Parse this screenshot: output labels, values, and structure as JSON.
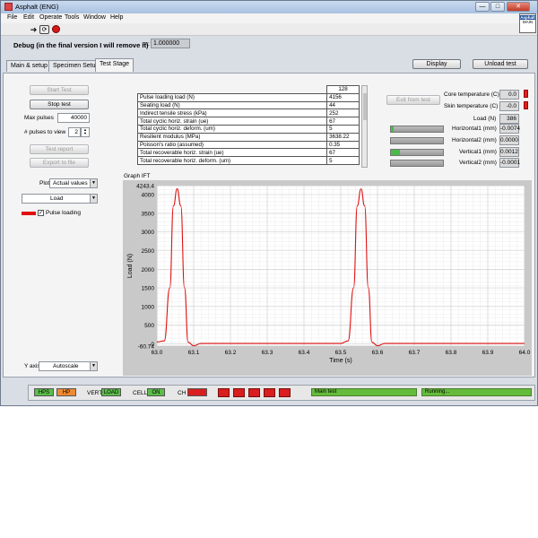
{
  "window": {
    "title": "Asphalt (ENG)",
    "min": "—",
    "max": "□",
    "close": "✕"
  },
  "menu": [
    "File",
    "Edit",
    "Operate",
    "Tools",
    "Window",
    "Help"
  ],
  "toolbar_icons": [
    "run-arrow-icon",
    "run-continuous-icon",
    "abort-stop-icon"
  ],
  "logo": {
    "line1": "Asphalt",
    "line2": "MAIN"
  },
  "debug": {
    "text": "Debug (in the final version I will remove it)",
    "m_label": "m:",
    "m_value": "1.000000"
  },
  "tabs": [
    "Main & setup",
    "Specimen Setup",
    "Test Stage"
  ],
  "active_tab": "Test Stage",
  "header_buttons": {
    "display": "Display",
    "unload": "Unload test"
  },
  "left": {
    "start": "Start Test",
    "stop": "Stop test",
    "max_pulses_label": "Max pulses",
    "max_pulses_value": "40000",
    "pulses_view_label": "# pulses to view",
    "pulses_view_value": "2",
    "report": "Test report",
    "export": "Export to file",
    "plot_label": "Plot",
    "plot_value": "Actual values",
    "channel_value": "Load",
    "legend_label": "Pulse loading",
    "yaxis_label": "Y axis",
    "yaxis_value": "Autoscale"
  },
  "table": {
    "counter": "128",
    "rows": [
      [
        "Pulse loading load (N)",
        "4156"
      ],
      [
        "Seating load (N)",
        "44"
      ],
      [
        "Indirect tensile stress (kPa)",
        "252"
      ],
      [
        "Total cyclic horiz. strain (ue)",
        "67"
      ],
      [
        "Total cyclic horiz. deform. (um)",
        "5"
      ],
      [
        "Resilient modulus (MPa)",
        "3638.22"
      ],
      [
        "Poisson's ratio (assumed)",
        "0.35"
      ],
      [
        "Total recoverable horiz. strain (ue)",
        "67"
      ],
      [
        "Total recoverable horiz. deform. (um)",
        "5"
      ]
    ]
  },
  "right": {
    "exit_button": "Exit from test",
    "core_label": "Core temperature (C)",
    "core_value": "0.0",
    "skin_label": "Skin temperature (C)",
    "skin_value": "-0.0",
    "load_label": "Load (N)",
    "load_value": "386",
    "h1_label": "Horizontal1 (mm)",
    "h1_value": "-0.0074",
    "h2_label": "Horizontal2 (mm)",
    "h2_value": "0.0000",
    "v1_label": "Vertical1 (mm)",
    "v1_value": "0.0012",
    "v2_label": "Vertical2 (mm)",
    "v2_value": "-0.0001"
  },
  "graph_title": "Graph IFT",
  "chart_data": {
    "type": "line",
    "title": "",
    "xlabel": "Time (s)",
    "ylabel": "Load (N)",
    "xlim": [
      63.0,
      64.0
    ],
    "ylim": [
      -60.74,
      4243.4
    ],
    "x_ticks": [
      "63.0",
      "63.1",
      "63.2",
      "63.3",
      "63.4",
      "63.5",
      "63.6",
      "63.7",
      "63.8",
      "63.9",
      "64.0"
    ],
    "y_ticks": [
      "4243.4",
      "4000",
      "3500",
      "3000",
      "2500",
      "2000",
      "1500",
      "1000",
      "500",
      "0",
      "-60.74"
    ],
    "grid": true,
    "series": [
      {
        "name": "Pulse loading",
        "color": "#e01010",
        "x": [
          63.0,
          63.02,
          63.035,
          63.045,
          63.055,
          63.065,
          63.075,
          63.085,
          63.1,
          63.12,
          63.2,
          63.3,
          63.4,
          63.5,
          63.52,
          63.535,
          63.545,
          63.555,
          63.565,
          63.575,
          63.585,
          63.6,
          63.62,
          63.7,
          63.8,
          63.9,
          64.0
        ],
        "y": [
          50,
          80,
          1500,
          3700,
          4160,
          3700,
          1500,
          40,
          -50,
          10,
          10,
          10,
          10,
          10,
          80,
          1500,
          3700,
          4156,
          3700,
          1500,
          40,
          -50,
          10,
          10,
          10,
          10,
          10
        ]
      }
    ]
  },
  "status": {
    "hps": "HPS",
    "hp": "HP",
    "vert_label": "VERT",
    "vert_value": "LOAD",
    "cell_label": "CELL",
    "cell_value": "ON",
    "ch_label": "CH",
    "main_test": "Main test",
    "running": "Running..."
  }
}
